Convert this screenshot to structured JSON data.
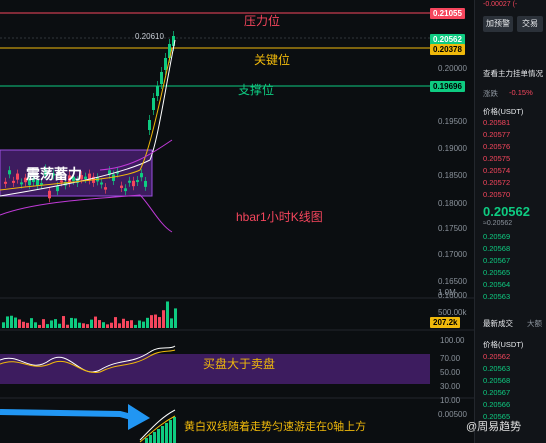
{
  "header": {
    "change": "-0.00027 (-"
  },
  "price_axis": {
    "levels": [
      "0.20000",
      "0.19500",
      "0.19000",
      "0.18500",
      "0.18000",
      "0.17500",
      "0.17000",
      "0.16500",
      "0.16000"
    ],
    "tag_resistance": "0.21055",
    "tag_current": "0.20562",
    "tag_key": "0.20378",
    "tag_support": "0.19696",
    "high_label": "0.20610"
  },
  "volume_axis": {
    "levels": [
      "1.0M",
      "500.00k"
    ],
    "tag": "207.2k"
  },
  "osc_axis": {
    "levels": [
      "100.00",
      "70.00",
      "50.00",
      "30.00",
      "10.00"
    ]
  },
  "macd_axis": {
    "levels": [
      "0.00500"
    ]
  },
  "annotations": {
    "resistance": "压力位",
    "key": "关键位",
    "support": "支撑位",
    "consolidation": "震荡蓄力",
    "chart_title": "hbar1小时K线图",
    "buy_pressure": "买盘大于卖盘",
    "trend_note": "黄白双线随着走势匀速游走在0轴上方"
  },
  "side_panel": {
    "btn_add": "加预警",
    "btn_trade": "交易",
    "section1": "查看主力挂单情况",
    "change_label": "涨跌",
    "change_value": "-0.15%",
    "price_header": "价格(USDT)",
    "asks": [
      "0.20581",
      "0.20577",
      "0.20576",
      "0.20575",
      "0.20574",
      "0.20572",
      "0.20570"
    ],
    "last_price": "0.20562",
    "last_sub": "≈0.20562",
    "bids": [
      "0.20569",
      "0.20568",
      "0.20567",
      "0.20565",
      "0.20564",
      "0.20563"
    ],
    "tabs": [
      "最新成交",
      "大额"
    ],
    "trades_header": "价格(USDT)",
    "trades": [
      "0.20562",
      "0.20563",
      "0.20568",
      "0.20567",
      "0.20566",
      "0.20565"
    ]
  },
  "watermark": "@周易趋势",
  "colors": {
    "up": "#0ecb81",
    "down": "#f6465d",
    "resistance": "#f6465d",
    "key": "#f0b90b",
    "support": "#0ecb81",
    "box": "#7b2fbe"
  }
}
